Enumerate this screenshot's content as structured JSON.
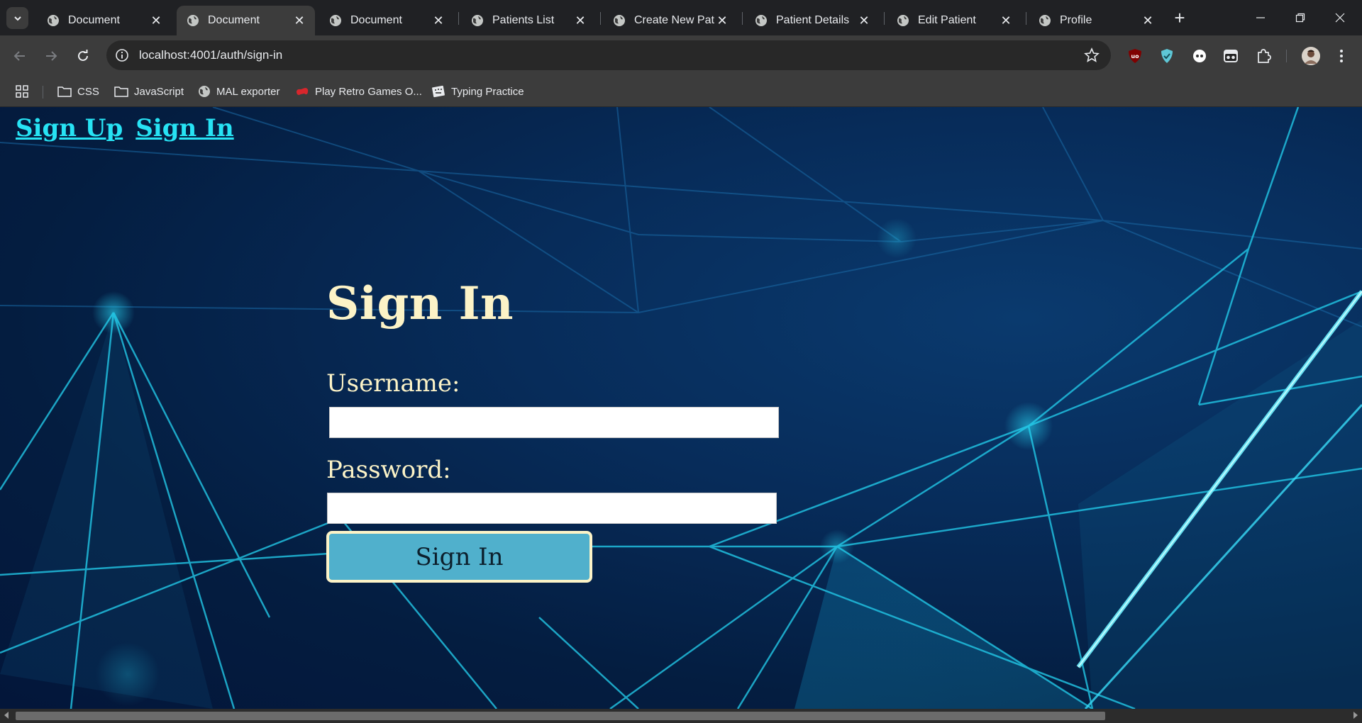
{
  "browser": {
    "tabs": [
      {
        "title": "Document",
        "active": false
      },
      {
        "title": "Document",
        "active": true
      },
      {
        "title": "Document",
        "active": false
      },
      {
        "title": "Patients List",
        "active": false
      },
      {
        "title": "Create New Patie",
        "active": false
      },
      {
        "title": "Patient Details",
        "active": false
      },
      {
        "title": "Edit Patient",
        "active": false
      },
      {
        "title": "Profile",
        "active": false
      }
    ],
    "url": "localhost:4001/auth/sign-in",
    "bookmarks": [
      {
        "label": "CSS",
        "icon": "folder-icon"
      },
      {
        "label": "JavaScript",
        "icon": "folder-icon"
      },
      {
        "label": "MAL exporter",
        "icon": "globe-icon"
      },
      {
        "label": "Play Retro Games O...",
        "icon": "gamepad-icon"
      },
      {
        "label": "Typing Practice",
        "icon": "keyboard-icon"
      }
    ]
  },
  "page": {
    "nav": {
      "sign_up": "Sign Up",
      "sign_in": "Sign In"
    },
    "form": {
      "title": "Sign In",
      "username_label": "Username:",
      "username_value": "",
      "password_label": "Password:",
      "password_value": "",
      "submit_label": "Sign In"
    }
  },
  "colors": {
    "heading": "#fcf3c7",
    "link": "#27e3f4",
    "button": "#50b0cc",
    "background": "#041d40"
  }
}
